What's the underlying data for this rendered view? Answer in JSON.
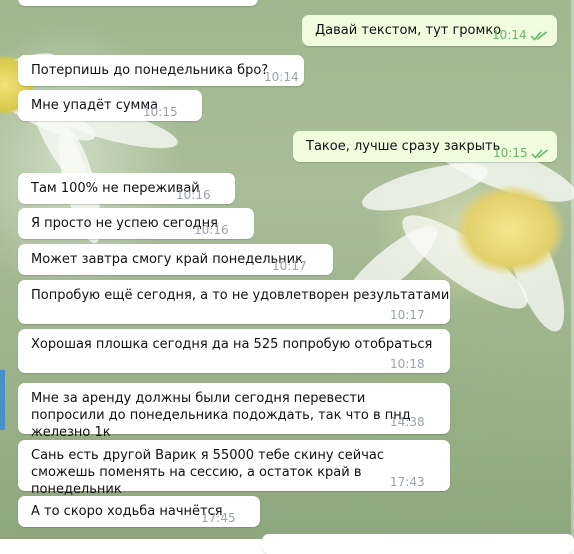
{
  "messages": [
    {
      "dir": "out",
      "text": "Давай текстом, тут громко",
      "time": "10:14",
      "read": true
    },
    {
      "dir": "in",
      "text": "Потерпишь до понедельника бро?",
      "time": "10:14"
    },
    {
      "dir": "in",
      "text": "Мне упадёт сумма",
      "time": "10:15"
    },
    {
      "dir": "out",
      "text": "Такое, лучше сразу закрыть",
      "time": "10:15",
      "read": true
    },
    {
      "dir": "in",
      "text": "Там 100% не переживай",
      "time": "10:16"
    },
    {
      "dir": "in",
      "text": "Я просто не успею сегодня",
      "time": "10:16"
    },
    {
      "dir": "in",
      "text": "Может завтра смогу край понедельник",
      "time": "10:17"
    },
    {
      "dir": "in",
      "text": "Попробую ещё сегодня, а то не удовлетворен результатами",
      "time": "10:17"
    },
    {
      "dir": "in",
      "text": "Хорошая плошка сегодня да на 525 попробую отобраться",
      "time": "10:18"
    },
    {
      "dir": "in",
      "text": "Мне за аренду должны были сегодня перевести попросили до понедельника подождать, так что в пнд железно 1к",
      "time": "14:38"
    },
    {
      "dir": "in",
      "text": "Сань есть другой Варик я 55000 тебе скину сейчас сможешь поменять на сессию, а остаток край в понедельник",
      "time": "17:43"
    },
    {
      "dir": "in",
      "text": "А то скоро ходьба начнётся",
      "time": "17:45"
    }
  ],
  "colors": {
    "incoming": "#ffffff",
    "outgoing": "#effdde",
    "time_out": "#6db56b",
    "time_in": "#9aa3ab",
    "accent": "#4a90c8"
  },
  "icons": {
    "read_receipt": "double-check-icon"
  }
}
